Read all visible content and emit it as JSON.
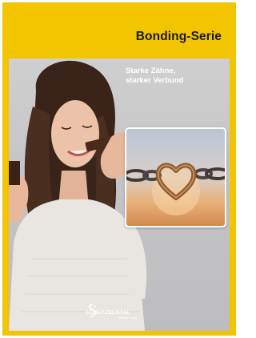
{
  "cover": {
    "series_title": "Bonding-Serie",
    "tagline": [
      "Starke Zähne,",
      "starker Verbund"
    ],
    "brand": {
      "name_left": "SCHÜTZ",
      "name_right": "DENTAL",
      "subline": "Medical Group"
    },
    "inset_image": "chain-heart-link",
    "main_image": "woman-biting-chocolate",
    "colors": {
      "brand_yellow": "#f3c400",
      "title_text": "#1a1a1a",
      "tagline_text": "#ffffff",
      "photo_background": "#c8c8ca"
    }
  }
}
